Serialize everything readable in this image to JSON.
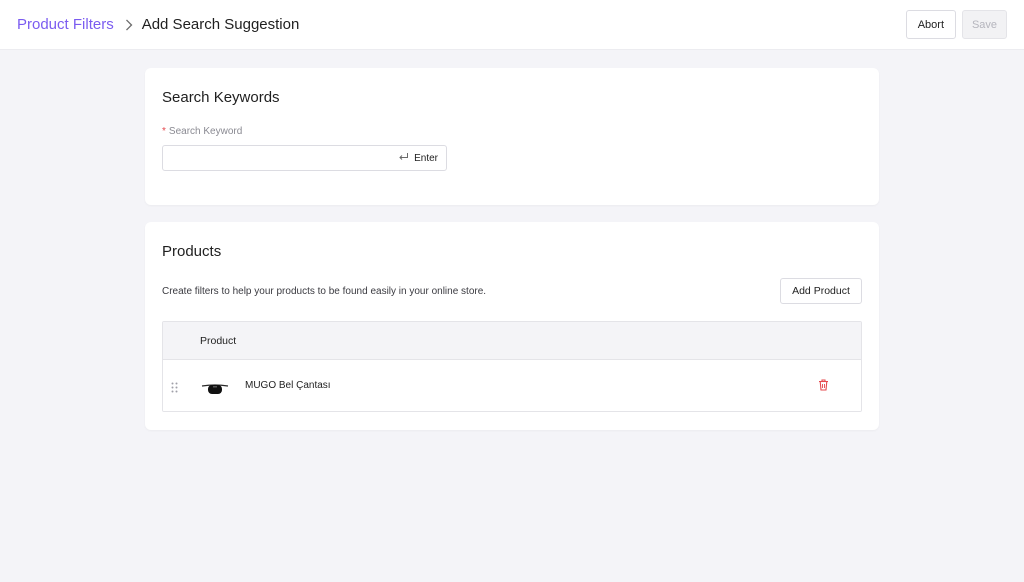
{
  "header": {
    "breadcrumb_parent": "Product Filters",
    "breadcrumb_current": "Add Search Suggestion",
    "abort_label": "Abort",
    "save_label": "Save"
  },
  "keywords": {
    "title": "Search Keywords",
    "field_label": "Search Keyword",
    "required_mark": "*",
    "input_value": "",
    "enter_hint": "Enter",
    "enter_icon": "return-arrow-icon"
  },
  "products": {
    "title": "Products",
    "description": "Create filters to help your products to be found easily in your online store.",
    "add_label": "Add Product",
    "columns": [
      "Product"
    ],
    "rows": [
      {
        "name": "MUGO Bel Çantası",
        "thumbnail_icon": "bag-thumbnail-icon",
        "delete_icon": "trash-icon"
      }
    ]
  },
  "colors": {
    "accent": "#7b5cf0",
    "danger": "#e5484d",
    "background": "#f4f4f8"
  }
}
